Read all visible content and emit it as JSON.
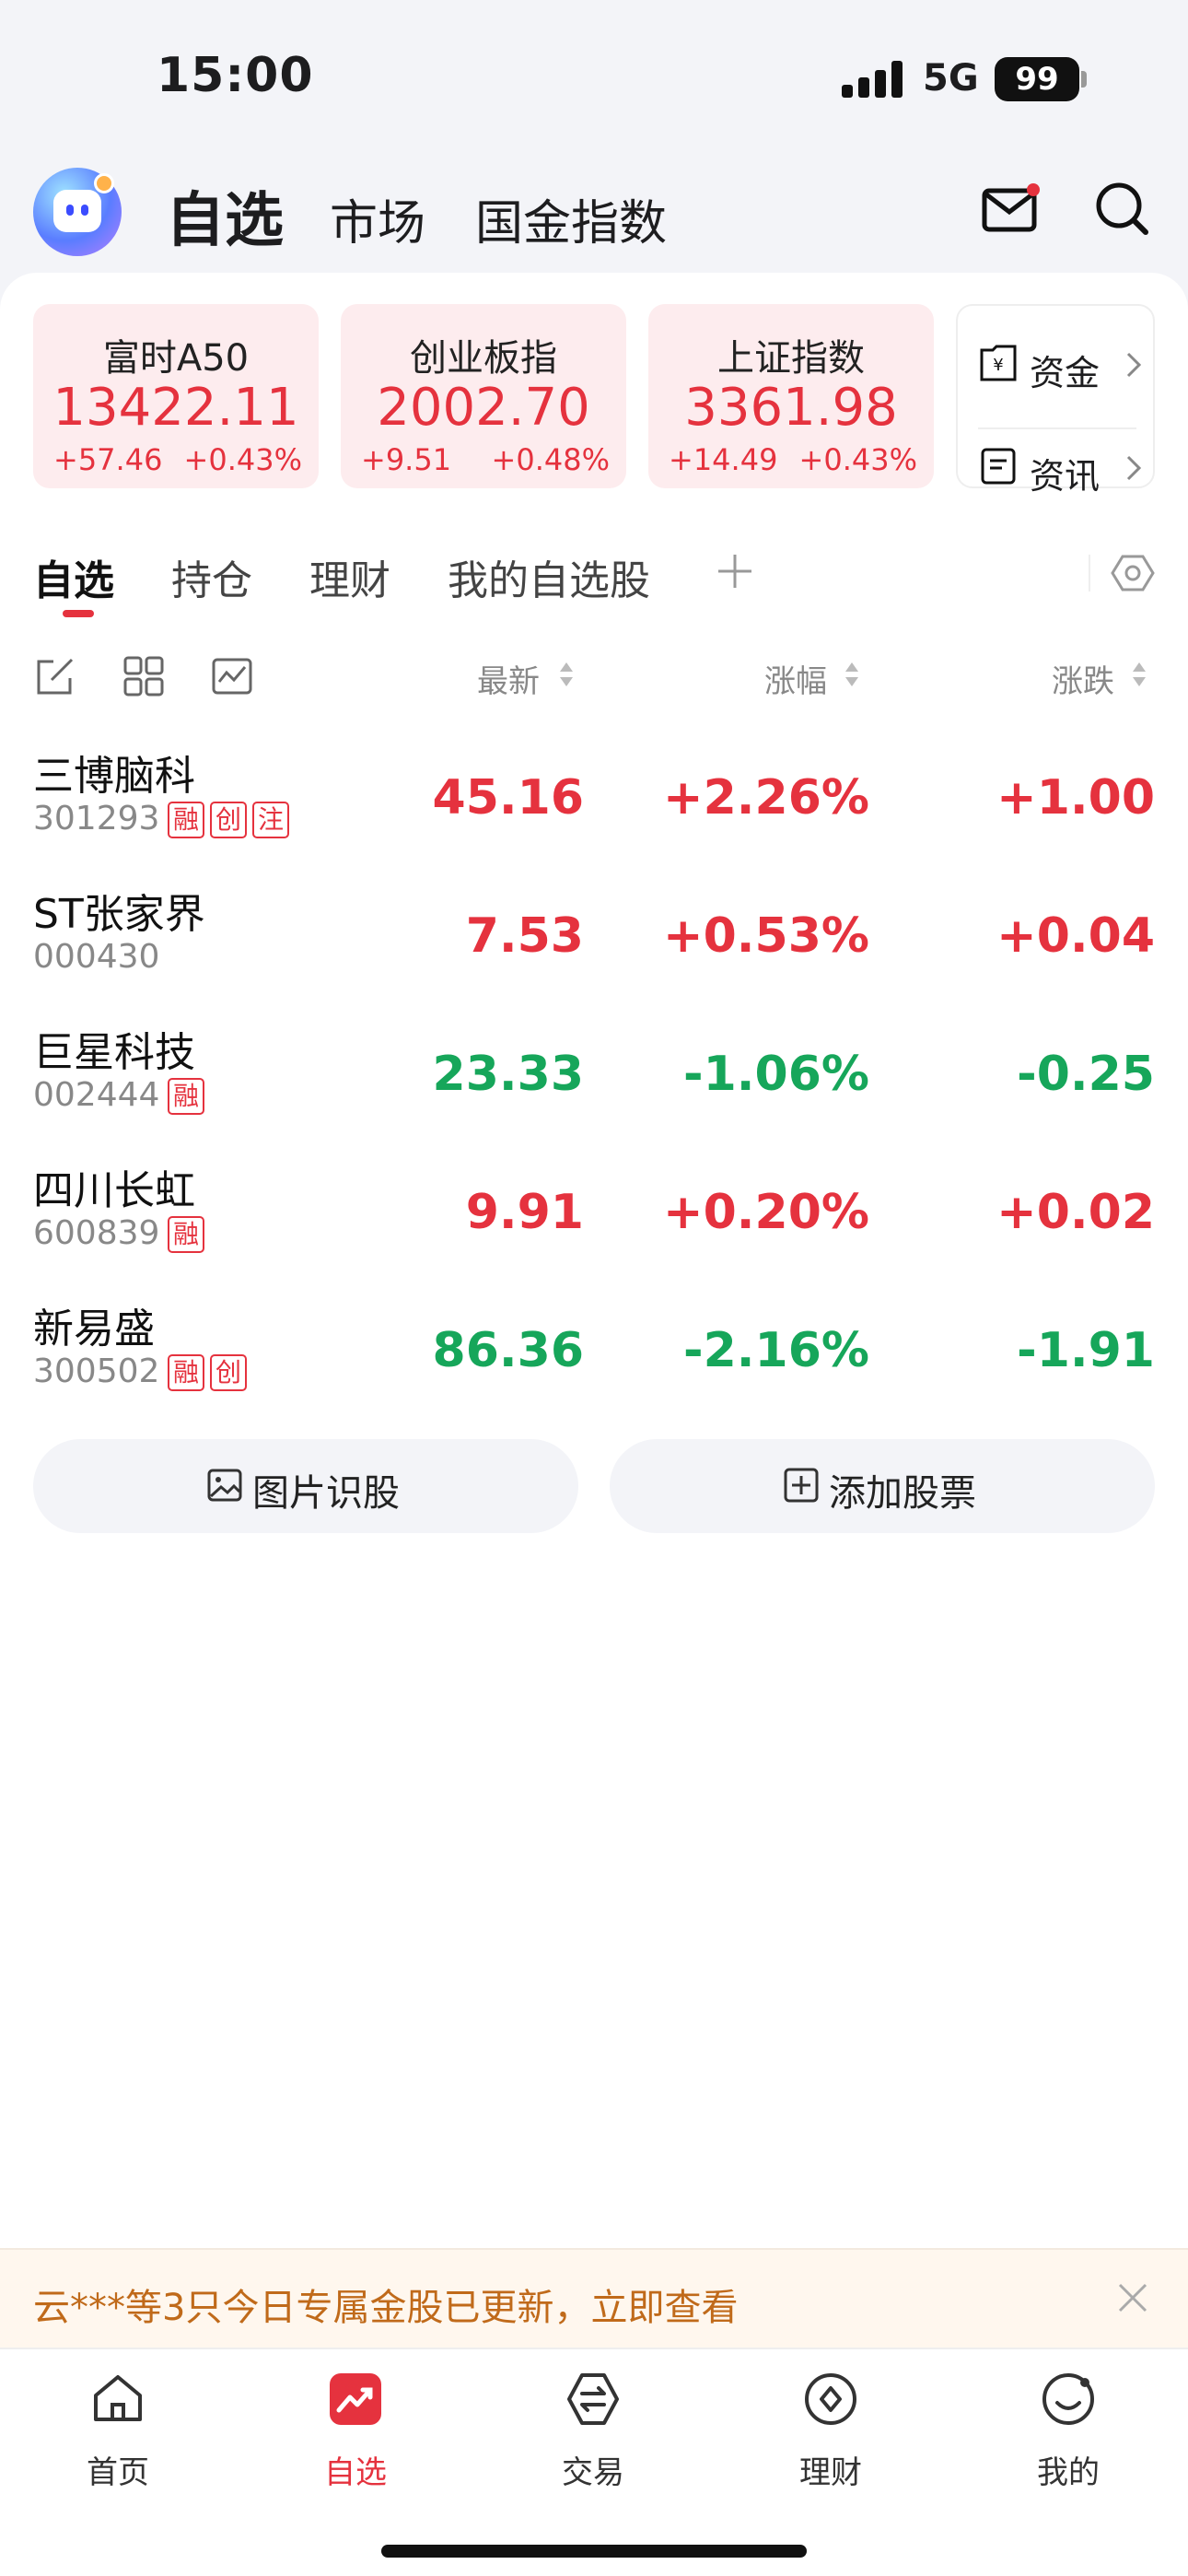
{
  "status_bar": {
    "time": "15:00",
    "network": "5G",
    "battery": "99"
  },
  "header": {
    "tabs": [
      {
        "label": "自选",
        "active": true
      },
      {
        "label": "市场",
        "active": false
      },
      {
        "label": "国金指数",
        "active": false
      }
    ],
    "icons": [
      "mail-icon",
      "search-icon"
    ]
  },
  "indices": [
    {
      "name": "富时A50",
      "value": "13422.11",
      "change": "+57.46",
      "pct": "+0.43%"
    },
    {
      "name": "创业板指",
      "value": "2002.70",
      "change": "+9.51",
      "pct": "+0.48%"
    },
    {
      "name": "上证指数",
      "value": "3361.98",
      "change": "+14.49",
      "pct": "+0.43%"
    }
  ],
  "side_links": [
    {
      "label": "资金",
      "icon": "fund-icon"
    },
    {
      "label": "资讯",
      "icon": "news-icon"
    }
  ],
  "tabs": [
    {
      "label": "自选",
      "active": true
    },
    {
      "label": "持仓",
      "active": false
    },
    {
      "label": "理财",
      "active": false
    },
    {
      "label": "我的自选股",
      "active": false
    }
  ],
  "columns": {
    "latest": "最新",
    "change_pct": "涨幅",
    "change": "涨跌"
  },
  "stocks": [
    {
      "name": "三博脑科",
      "code": "301293",
      "tags": [
        "融",
        "创",
        "注"
      ],
      "price": "45.16",
      "pct": "+2.26%",
      "change": "+1.00",
      "trend": "up"
    },
    {
      "name": "ST张家界",
      "code": "000430",
      "tags": [],
      "price": "7.53",
      "pct": "+0.53%",
      "change": "+0.04",
      "trend": "up"
    },
    {
      "name": "巨星科技",
      "code": "002444",
      "tags": [
        "融"
      ],
      "price": "23.33",
      "pct": "-1.06%",
      "change": "-0.25",
      "trend": "down"
    },
    {
      "name": "四川长虹",
      "code": "600839",
      "tags": [
        "融"
      ],
      "price": "9.91",
      "pct": "+0.20%",
      "change": "+0.02",
      "trend": "up"
    },
    {
      "name": "新易盛",
      "code": "300502",
      "tags": [
        "融",
        "创"
      ],
      "price": "86.36",
      "pct": "-2.16%",
      "change": "-1.91",
      "trend": "down"
    }
  ],
  "actions": {
    "image_recognition": "图片识股",
    "add_stock": "添加股票"
  },
  "promo": {
    "text": "云***等3只今日专属金股已更新，立即查看"
  },
  "tabbar": [
    {
      "label": "首页",
      "icon": "home-icon",
      "active": false
    },
    {
      "label": "自选",
      "icon": "watchlist-icon",
      "active": true
    },
    {
      "label": "交易",
      "icon": "trade-icon",
      "active": false
    },
    {
      "label": "理财",
      "icon": "wealth-icon",
      "active": false
    },
    {
      "label": "我的",
      "icon": "profile-icon",
      "active": false
    }
  ],
  "colors": {
    "up": "#e5323e",
    "down": "#16a65a",
    "accent": "#e5323e"
  }
}
